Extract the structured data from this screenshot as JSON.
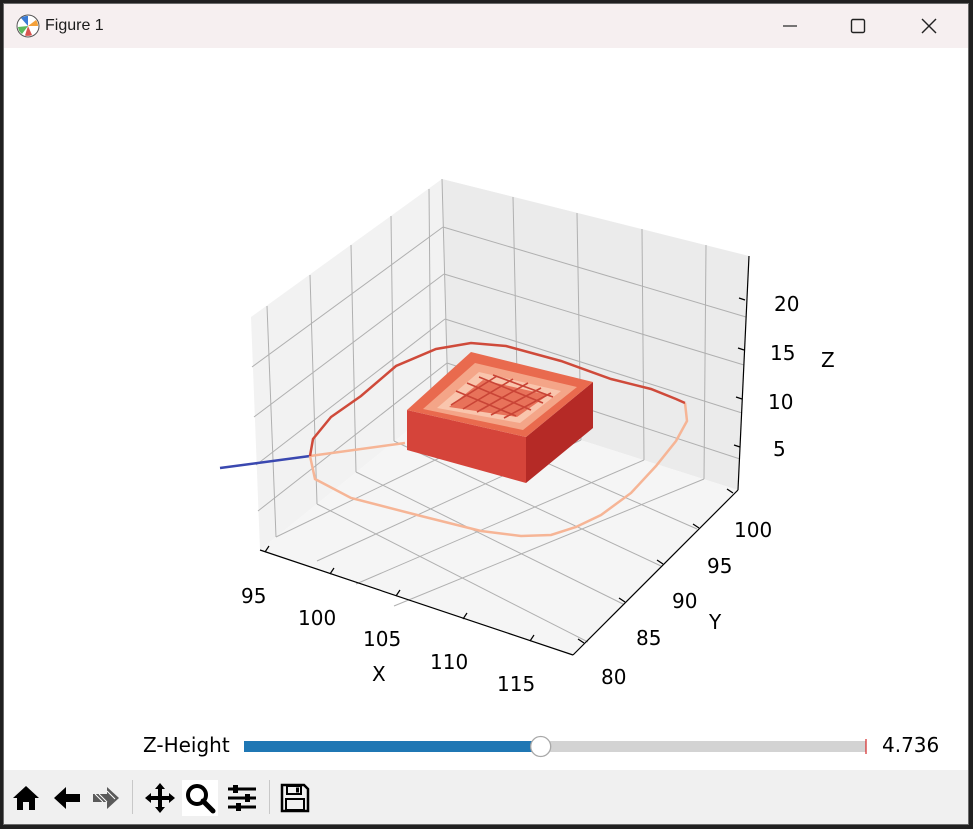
{
  "window": {
    "title": "Figure 1",
    "controls": [
      "minimize-icon",
      "maximize-icon",
      "close-icon"
    ]
  },
  "chart_data": {
    "type": "3d-line",
    "xlabel": "X",
    "ylabel": "Y",
    "zlabel": "Z",
    "x_ticks": [
      "95",
      "100",
      "105",
      "110",
      "115"
    ],
    "y_ticks": [
      "80",
      "85",
      "90",
      "95",
      "100"
    ],
    "z_ticks": [
      "5",
      "10",
      "15",
      "20"
    ],
    "xlim": [
      93,
      117
    ],
    "ylim": [
      78,
      102
    ],
    "zlim": [
      0,
      24
    ],
    "grid": true,
    "colormap": "Reds",
    "series": [
      {
        "kind": "travel-line",
        "color": "#3a48b0"
      },
      {
        "kind": "skirt-outer",
        "color": "#cf4a3a"
      },
      {
        "kind": "skirt-inner",
        "color": "#f6b596"
      },
      {
        "kind": "printed-part-block",
        "color": "#c9332c"
      }
    ]
  },
  "slider": {
    "label": "Z-Height",
    "value": "4.736",
    "fraction": 0.477,
    "fill_color": "#1f77b4",
    "track_color": "#d3d3d3"
  },
  "toolbar": {
    "buttons": [
      {
        "name": "home-icon"
      },
      {
        "name": "back-icon"
      },
      {
        "name": "forward-icon"
      },
      {
        "name": "pan-icon"
      },
      {
        "name": "zoom-icon",
        "active": true
      },
      {
        "name": "configure-subplots-icon"
      },
      {
        "name": "save-icon"
      }
    ]
  }
}
